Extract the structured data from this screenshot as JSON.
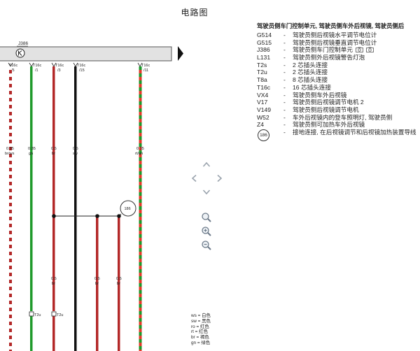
{
  "title": "电路图",
  "diagram": {
    "component_label": "J386",
    "connector_labels": [
      "T16c\n/5",
      "T16c\n/1",
      "T16c\n/3",
      "T16c\n/15",
      "T16c\n/11"
    ],
    "wires": [
      {
        "size": "0.35",
        "color": "br/ws"
      },
      {
        "size": "0.35",
        "color": "gn"
      },
      {
        "size": "0.5",
        "color": "br"
      },
      {
        "size": "0.5",
        "color": "sw"
      },
      {
        "size": "0.35",
        "color": "rt/gn"
      }
    ],
    "lower_wires": [
      {
        "size": "0.5",
        "color": "br"
      },
      {
        "size": "0.5",
        "color": "br"
      },
      {
        "size": "0.5",
        "color": "br"
      }
    ],
    "ground_label": "186",
    "bottom_connectors": [
      "T2u",
      "T2u"
    ]
  },
  "legend": {
    "heading": "驾驶员侧车门控制单元, 驾驶员侧车外后视镜, 驾驶员侧后",
    "items": [
      {
        "code": "G514",
        "desc": "驾驶员侧后视镜水平调节电位计"
      },
      {
        "code": "G515",
        "desc": "驾驶员侧后视镜垂直调节电位计"
      },
      {
        "code": "J386",
        "desc": "驾驶员侧车门控制单元"
      },
      {
        "code": "L131",
        "desc": "驾驶员侧外后视镜警告灯泡"
      },
      {
        "code": "T2s",
        "desc": "2 芯插头连接"
      },
      {
        "code": "T2u",
        "desc": "2 芯插头连接"
      },
      {
        "code": "T8a",
        "desc": "8 芯插头连接"
      },
      {
        "code": "T16c",
        "desc": "16 芯插头连接"
      },
      {
        "code": "VX4",
        "desc": "驾驶员侧车外后视镜"
      },
      {
        "code": "V17",
        "desc": "驾驶员侧后视镜调节电机 2"
      },
      {
        "code": "V149",
        "desc": "驾驶员侧后视镜调节电机"
      },
      {
        "code": "W52",
        "desc": "车外后视镜内的登车照明灯, 驾驶员侧"
      },
      {
        "code": "Z4",
        "desc": "驾驶员侧可加热车外后视镜"
      }
    ],
    "ground": {
      "code": "186",
      "desc": "接地连接, 在后视镜调节和后视镜加热装置导线"
    }
  },
  "color_key": [
    "ws = 白色",
    "sw = 黑色",
    "ro = 红色",
    "rt = 红色",
    "br = 褐色",
    "gn = 绿色"
  ],
  "icons": {
    "camera": "camera-icon",
    "nav_up": "chevron-up-icon",
    "nav_left": "chevron-left-icon",
    "nav_right": "chevron-right-icon",
    "nav_down": "chevron-down-icon",
    "zoom_fit": "zoom-fit-icon",
    "zoom_in": "zoom-in-icon",
    "zoom_out": "zoom-out-icon"
  }
}
